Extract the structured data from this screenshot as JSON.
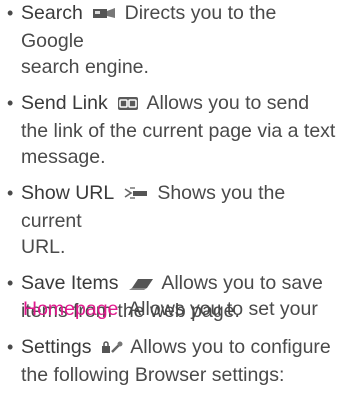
{
  "items": [
    {
      "term": "Search",
      "icon": "search-flag-icon",
      "description_lines": [
        "Directs you to the Google",
        "search engine."
      ]
    },
    {
      "term": "Send Link",
      "icon": "send-link-icon",
      "description_lines": [
        "Allows you to send",
        "the link of the current page via a text",
        "message."
      ]
    },
    {
      "term": "Show URL",
      "icon": "show-url-icon",
      "description_lines": [
        "Shows you the current",
        "URL."
      ]
    },
    {
      "term": "Save Items",
      "icon": "save-items-icon",
      "description_lines": [
        "Allows you to save",
        "items from the web page."
      ]
    },
    {
      "term": "Settings",
      "icon": "settings-icon",
      "description_lines": [
        "Allows you to configure",
        "the following Browser settings:"
      ]
    }
  ],
  "sub_entry": {
    "term": "Homepage",
    "description": "Allows you to set your"
  },
  "colors": {
    "text": "#4a4a4a",
    "accent": "#e0198d"
  }
}
